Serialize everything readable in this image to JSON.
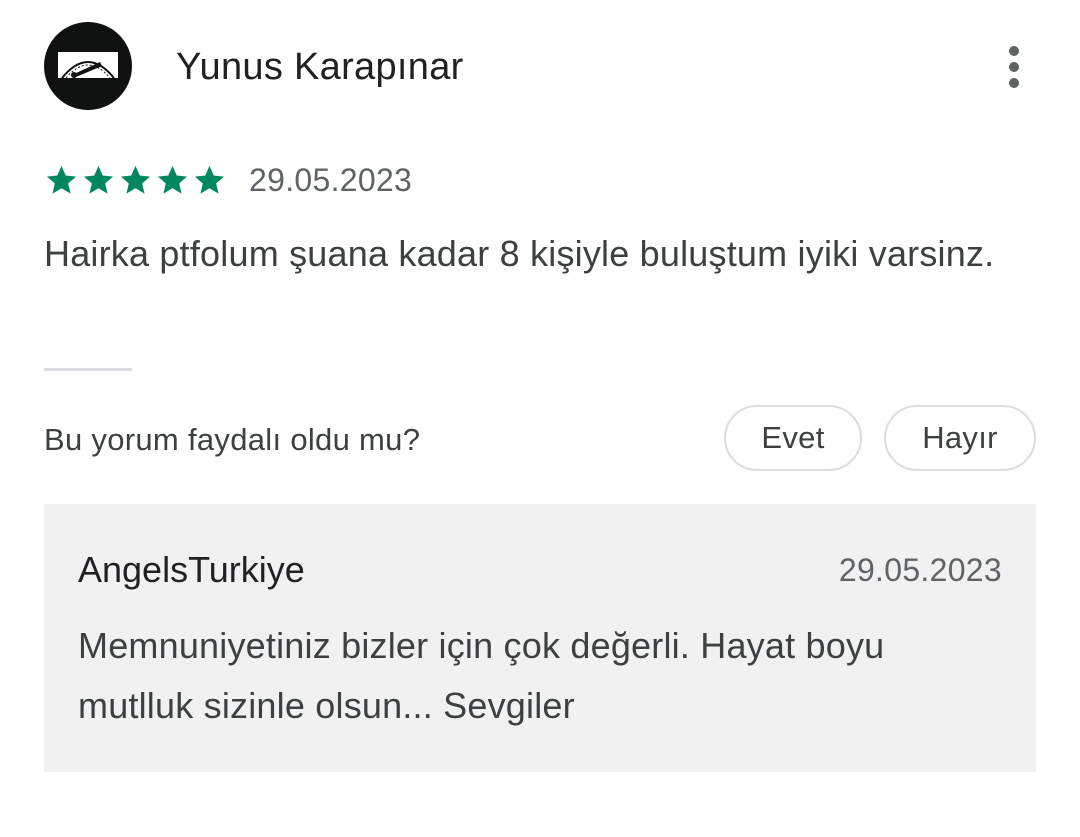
{
  "review": {
    "author": "Yunus Karapınar",
    "avatar_icon": "profile-logo",
    "more_icon": "more-vert-icon",
    "rating": 5,
    "max_rating": 5,
    "star_color": "#01875f",
    "date": "29.05.2023",
    "text": "Hairka ptfolum şuana kadar 8 kişiyle buluştum iyiki varsinz."
  },
  "helpful": {
    "question": "Bu yorum faydalı oldu mu?",
    "yes_label": "Evet",
    "no_label": "Hayır"
  },
  "reply": {
    "author": "AngelsTurkiye",
    "date": "29.05.2023",
    "text": "Memnuniyetiniz bizler için çok değerli. Hayat boyu mutlluk sizinle olsun... Sevgiler"
  }
}
